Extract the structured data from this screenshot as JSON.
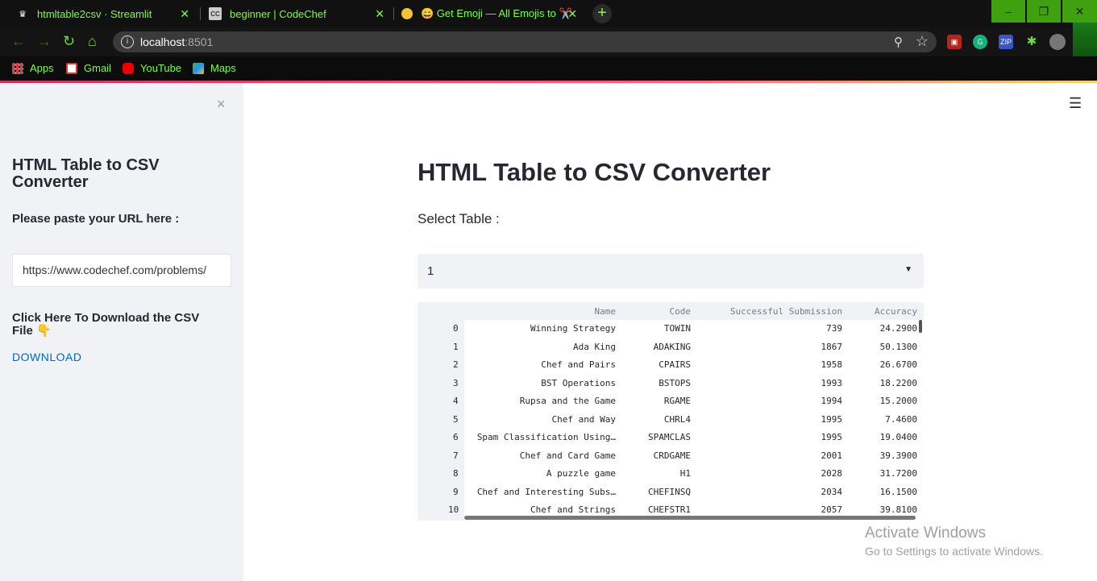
{
  "browser": {
    "tabs": [
      {
        "title": "htmltable2csv · Streamlit",
        "icon": "streamlit-crown-icon"
      },
      {
        "title": "beginner | CodeChef",
        "icon": "codechef-icon"
      },
      {
        "title": "😄 Get Emoji — All Emojis to ✂️",
        "icon": "emoji-icon"
      }
    ],
    "new_tab": "+",
    "window_controls": {
      "minimize": "–",
      "restore": "❐",
      "close": "✕"
    },
    "url_host": "localhost",
    "url_port": ":8501",
    "bookmarks": [
      {
        "label": "Apps",
        "icon": "apps-grid-icon"
      },
      {
        "label": "Gmail",
        "icon": "gmail-icon"
      },
      {
        "label": "YouTube",
        "icon": "youtube-icon"
      },
      {
        "label": "Maps",
        "icon": "maps-icon"
      }
    ],
    "extensions": [
      "pdf",
      "grammarly",
      "zip",
      "puzzle",
      "profile"
    ]
  },
  "sidebar": {
    "close": "×",
    "title": "HTML Table to CSV Converter",
    "url_label": "Please paste your URL here :",
    "url_value": "https://www.codechef.com/problems/",
    "download_text": "Click Here To Download the CSV File 👇",
    "download_link": "DOWNLOAD"
  },
  "main": {
    "menu": "☰",
    "title": "HTML Table to CSV Converter",
    "select_label": "Select Table :",
    "select_value": "1",
    "table": {
      "columns": [
        "Name",
        "Code",
        "Successful Submission",
        "Accuracy"
      ],
      "rows": [
        {
          "index": "0",
          "name": "Winning Strategy",
          "code": "TOWIN",
          "subs": "739",
          "acc": "24.2900"
        },
        {
          "index": "1",
          "name": "Ada King",
          "code": "ADAKING",
          "subs": "1867",
          "acc": "50.1300"
        },
        {
          "index": "2",
          "name": "Chef and Pairs",
          "code": "CPAIRS",
          "subs": "1958",
          "acc": "26.6700"
        },
        {
          "index": "3",
          "name": "BST Operations",
          "code": "BSTOPS",
          "subs": "1993",
          "acc": "18.2200"
        },
        {
          "index": "4",
          "name": "Rupsa and the Game",
          "code": "RGAME",
          "subs": "1994",
          "acc": "15.2000"
        },
        {
          "index": "5",
          "name": "Chef and Way",
          "code": "CHRL4",
          "subs": "1995",
          "acc": "7.4600"
        },
        {
          "index": "6",
          "name": "Spam Classification Using…",
          "code": "SPAMCLAS",
          "subs": "1995",
          "acc": "19.0400"
        },
        {
          "index": "7",
          "name": "Chef and Card Game",
          "code": "CRDGAME",
          "subs": "2001",
          "acc": "39.3900"
        },
        {
          "index": "8",
          "name": "A puzzle game",
          "code": "H1",
          "subs": "2028",
          "acc": "31.7200"
        },
        {
          "index": "9",
          "name": "Chef and Interesting Subs…",
          "code": "CHEFINSQ",
          "subs": "2034",
          "acc": "16.1500"
        },
        {
          "index": "10",
          "name": "Chef and Strings",
          "code": "CHEFSTR1",
          "subs": "2057",
          "acc": "39.8100"
        }
      ]
    }
  },
  "watermark": {
    "line1": "Activate Windows",
    "line2": "Go to Settings to activate Windows."
  }
}
